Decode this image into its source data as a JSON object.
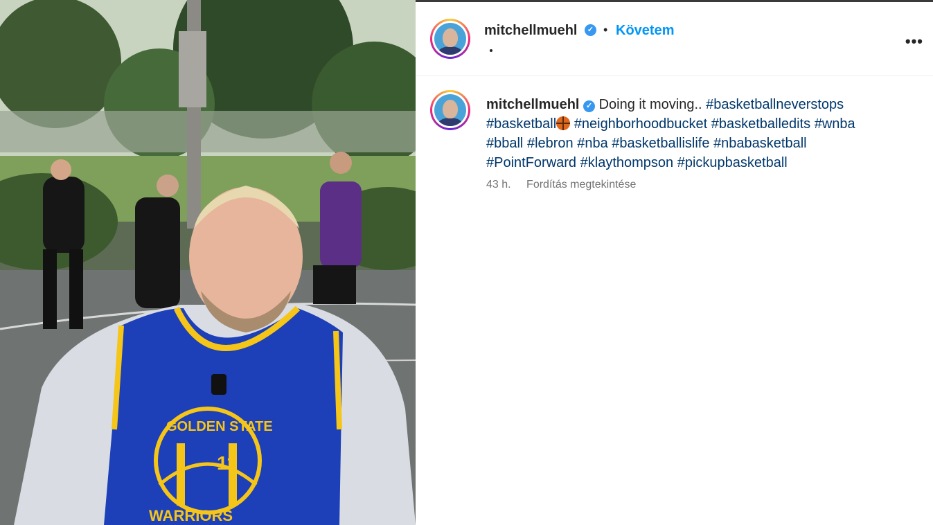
{
  "post": {
    "username": "mitchellmuehl",
    "follow_label": "Követem",
    "separator": "•",
    "more_label": "•••",
    "verified_mark": "✓"
  },
  "caption": {
    "username": "mitchellmuehl",
    "text": "Doing it moving..",
    "line1_tags": [
      "#basketballneverstops"
    ],
    "line2_tag_before_emoji": "#basketball",
    "emoji": "basketball-emoji",
    "line2_tags": [
      "#neighborhoodbucket",
      "#basketballedits",
      "#wnba"
    ],
    "line3_tags": [
      "#bball",
      "#lebron",
      "#nba",
      "#basketballislife",
      "#nbabasketball"
    ],
    "line4_tags": [
      "#PointForward",
      "#klaythompson",
      "#pickupbasketball"
    ]
  },
  "meta": {
    "time": "43 h.",
    "translate_label": "Fordítás megtekintése"
  },
  "media": {
    "jersey_text": "GOLDEN STATE",
    "jersey_number": "11",
    "jersey_bottom": "WARRIORS"
  },
  "colors": {
    "link": "#0095f6",
    "hashtag": "#00376b",
    "verified": "#3897f0",
    "jersey_blue": "#1d3fb8",
    "jersey_gold": "#f5c518"
  }
}
